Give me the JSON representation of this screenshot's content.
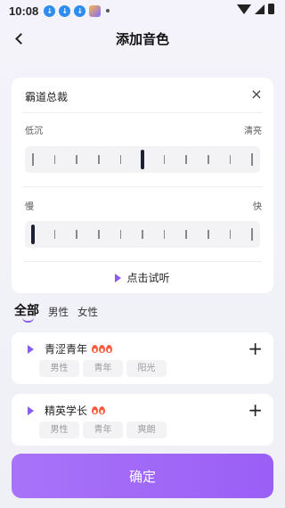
{
  "status_bar": {
    "time": "10:08"
  },
  "header": {
    "title": "添加音色"
  },
  "card": {
    "voice_name": "霸道总裁",
    "close_label": "×",
    "pitch": {
      "low_label": "低沉",
      "high_label": "清亮",
      "value": 0.5
    },
    "speed": {
      "slow_label": "慢",
      "fast_label": "快",
      "value": 0.0
    },
    "preview_label": "点击试听"
  },
  "tabs": [
    {
      "label": "全部",
      "active": true
    },
    {
      "label": "男性",
      "active": false
    },
    {
      "label": "女性",
      "active": false
    }
  ],
  "voices": [
    {
      "name": "青涩青年",
      "flames": 3,
      "tags": [
        "男性",
        "青年",
        "阳光"
      ]
    },
    {
      "name": "精英学长",
      "flames": 2,
      "tags": [
        "男性",
        "青年",
        "爽朗"
      ]
    }
  ],
  "confirm_label": "确定",
  "colors": {
    "accent": "#8a5cf6",
    "flame": "#ff5a3c"
  },
  "icons": {
    "back": "chevron-left-icon",
    "close": "close-icon",
    "play": "play-icon",
    "add": "plus-icon",
    "hot": "flame-icon"
  }
}
